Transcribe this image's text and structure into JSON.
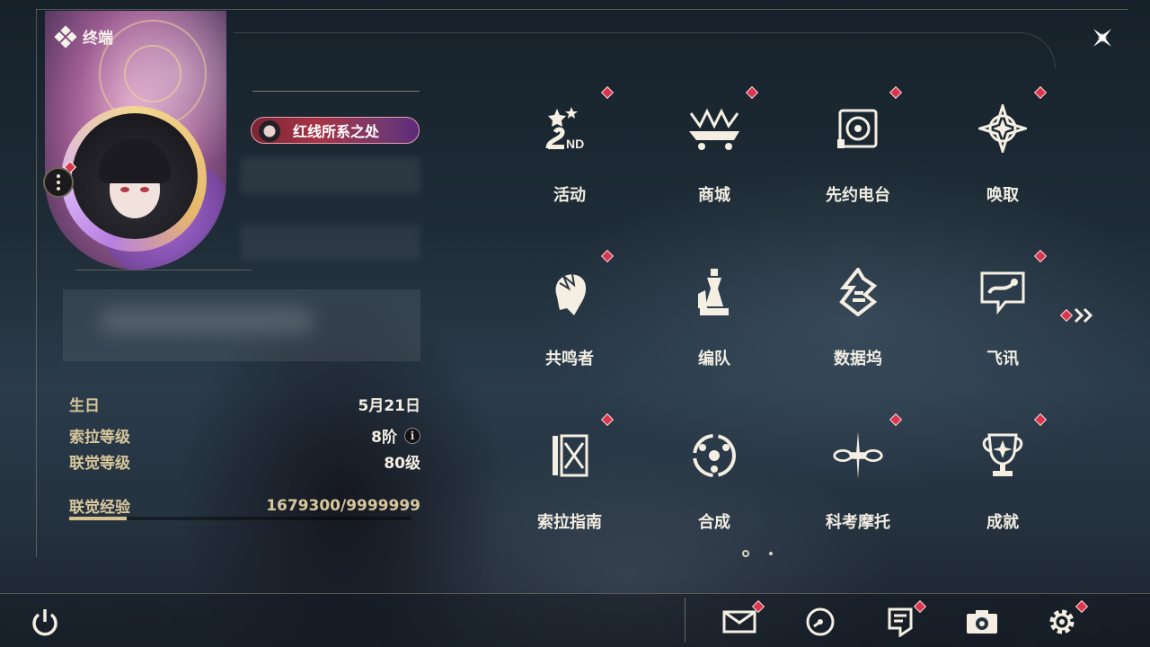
{
  "header": {
    "title": "终端",
    "close_label": "close"
  },
  "profile": {
    "title_badge": "红线所系之处",
    "stats": [
      {
        "key": "生日",
        "value": "5月21日"
      },
      {
        "key": "索拉等级",
        "value": "8阶"
      },
      {
        "key": "联觉等级",
        "value": "80级"
      },
      {
        "key": "联觉经验",
        "value": "1679300/9999999"
      }
    ],
    "exp_progress": 0.168
  },
  "menu": {
    "items": [
      {
        "label": "活动",
        "icon": "activity-2nd-icon",
        "badge": true
      },
      {
        "label": "商城",
        "icon": "shop-crown-cart-icon",
        "badge": true
      },
      {
        "label": "先约电台",
        "icon": "radio-icon",
        "badge": true
      },
      {
        "label": "唤取",
        "icon": "summon-star-icon",
        "badge": true
      },
      {
        "label": "共鸣者",
        "icon": "resonator-head-icon",
        "badge": true
      },
      {
        "label": "编队",
        "icon": "chess-team-icon",
        "badge": false
      },
      {
        "label": "数据坞",
        "icon": "data-bank-icon",
        "badge": false
      },
      {
        "label": "飞讯",
        "icon": "chat-message-icon",
        "badge": true
      },
      {
        "label": "索拉指南",
        "icon": "guide-book-icon",
        "badge": true
      },
      {
        "label": "合成",
        "icon": "synthesis-icon",
        "badge": false
      },
      {
        "label": "科考摩托",
        "icon": "motorcycle-icon",
        "badge": true
      },
      {
        "label": "成就",
        "icon": "trophy-icon",
        "badge": true
      }
    ],
    "page_count": 2,
    "current_page": 1
  },
  "bottom_bar": {
    "buttons": [
      {
        "icon": "mail-icon",
        "badge": true
      },
      {
        "icon": "clock-icon",
        "badge": false
      },
      {
        "icon": "notice-icon",
        "badge": true
      },
      {
        "icon": "camera-icon",
        "badge": false
      },
      {
        "icon": "settings-gear-icon",
        "badge": true
      }
    ]
  },
  "colors": {
    "badge_red": "#d9364d",
    "gold": "#d7c18e",
    "text": "#f1ede2"
  }
}
